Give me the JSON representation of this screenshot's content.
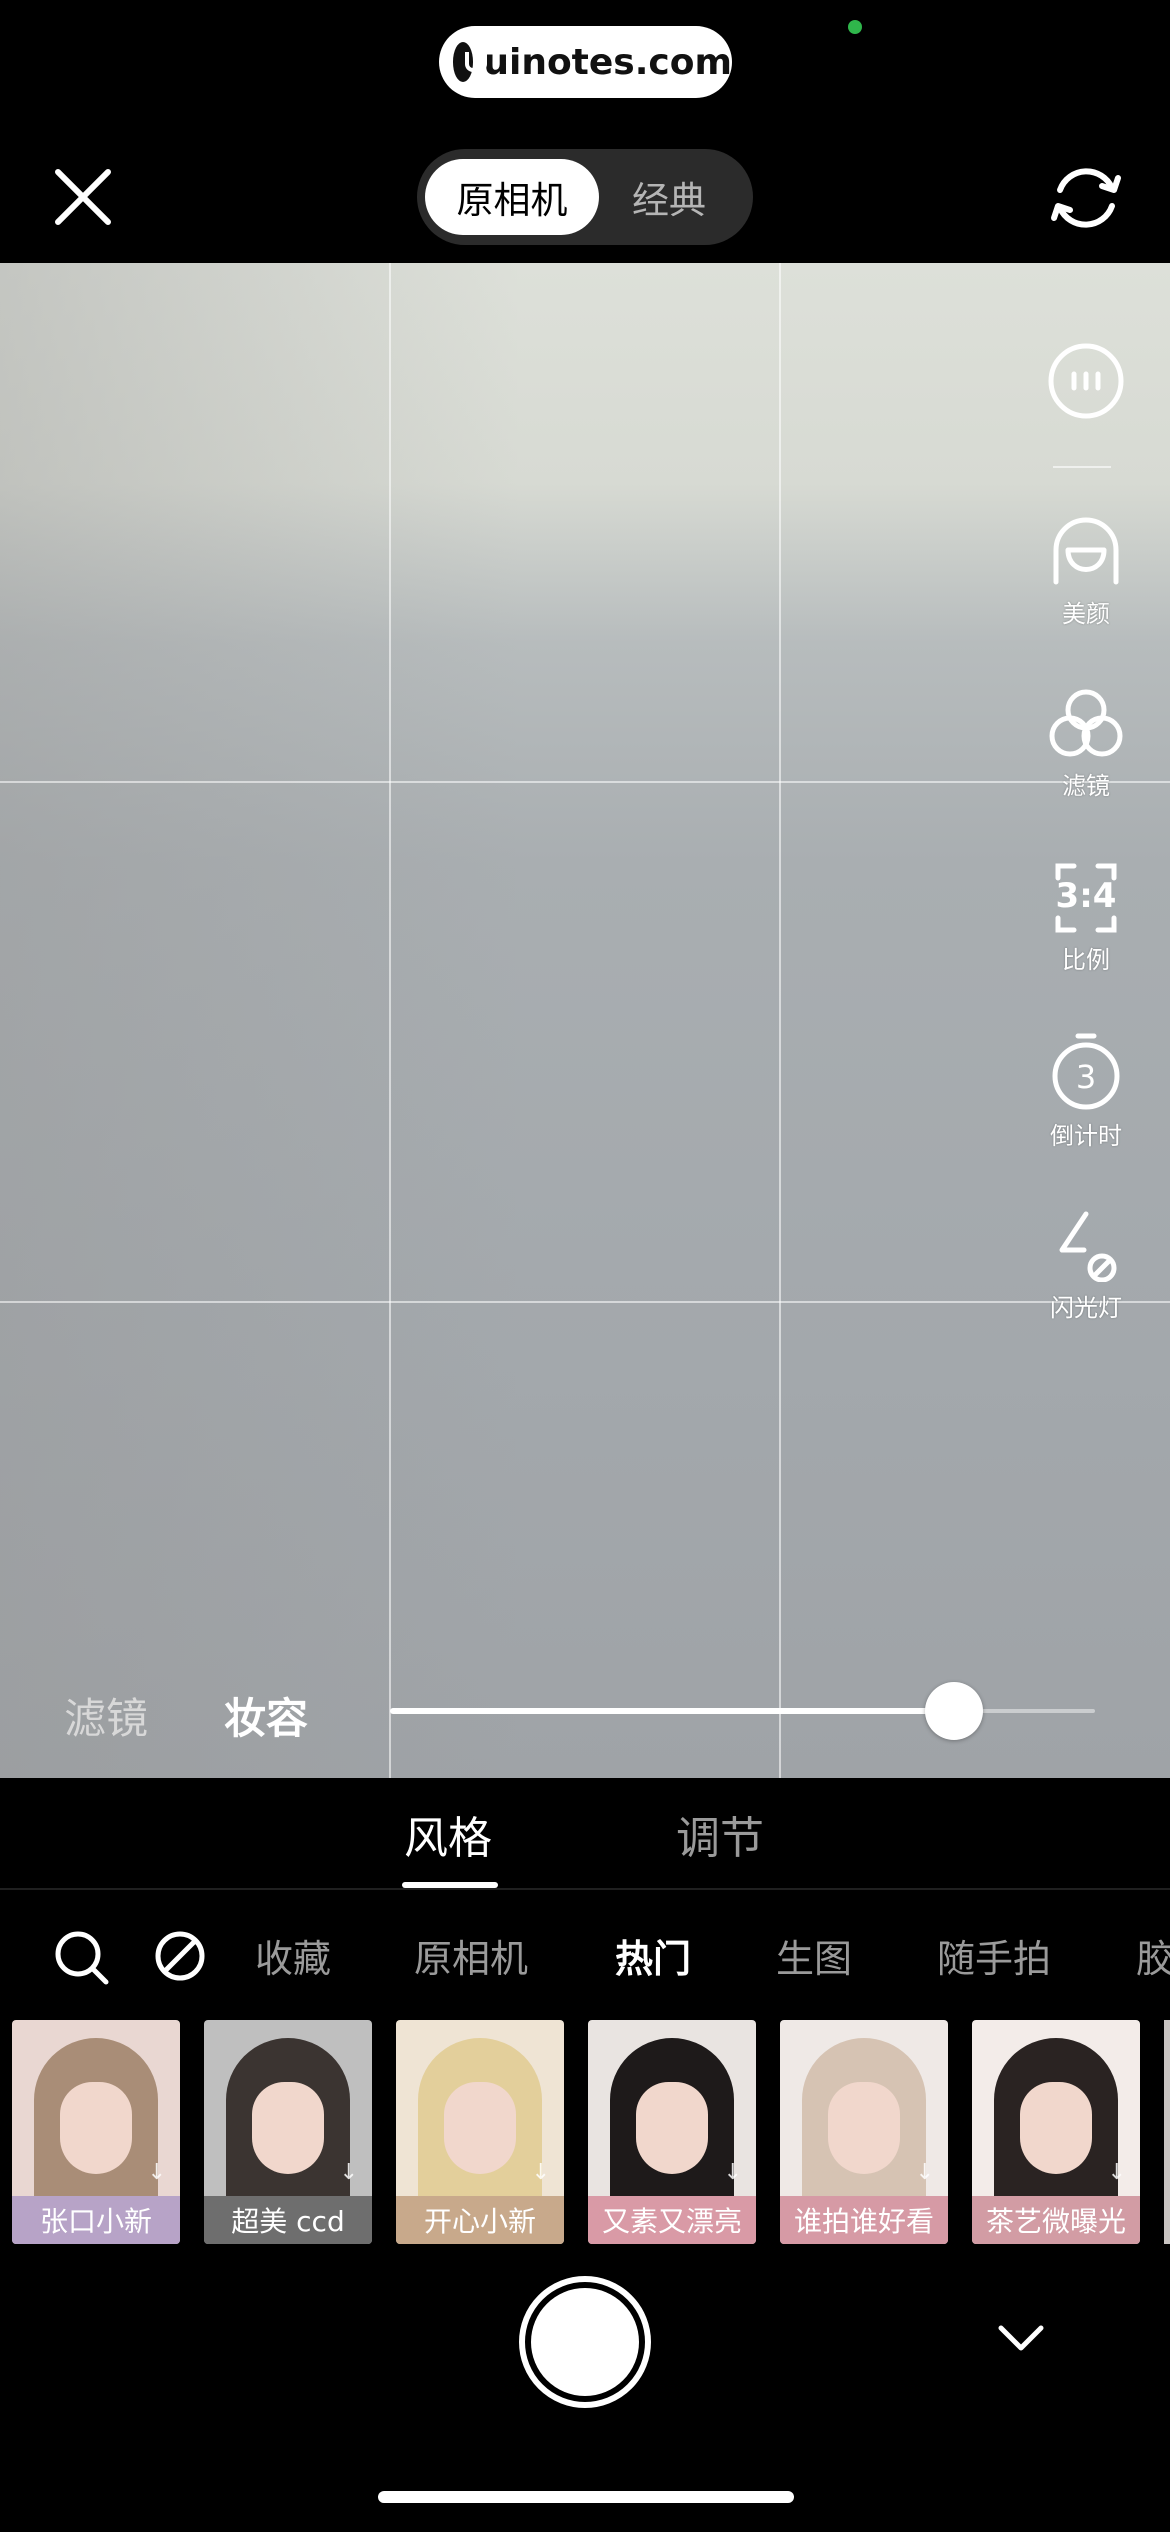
{
  "watermark": {
    "text": "uinotes.com"
  },
  "top_bar": {
    "close_icon": "close-icon",
    "modes": [
      "原相机",
      "经典"
    ],
    "active_mode": "原相机",
    "switch_camera_icon": "switch-camera-icon"
  },
  "side_tools": {
    "more_icon": "more-icon",
    "items": [
      {
        "label": "美颜",
        "icon": "beauty-icon"
      },
      {
        "label": "滤镜",
        "icon": "filter-icon"
      },
      {
        "label": "比例",
        "icon": "ratio-icon",
        "value": "3:4"
      },
      {
        "label": "倒计时",
        "icon": "timer-icon",
        "value": "3"
      },
      {
        "label": "闪光灯",
        "icon": "flash-off-icon"
      }
    ]
  },
  "intensity": {
    "tabs": [
      "滤镜",
      "妆容"
    ],
    "active_tab": "妆容",
    "value_fraction": 0.8
  },
  "panel": {
    "tabs": [
      "风格",
      "调节"
    ],
    "active_tab": "风格",
    "categories": [
      "收藏",
      "原相机",
      "热门",
      "生图",
      "随手拍",
      "胶"
    ],
    "active_category": "热门",
    "filters": [
      {
        "label": "张口小新",
        "label_bg": "#b7a3c7",
        "bg": "#e9d7d2",
        "hair": "#a98d77"
      },
      {
        "label": "超美 ccd",
        "label_bg": "#6e6e6e",
        "bg": "#bfbfbf",
        "hair": "#3b3431"
      },
      {
        "label": "开心小新",
        "label_bg": "#c8a98b",
        "bg": "#efe4d4",
        "hair": "#e3cf9b"
      },
      {
        "label": "又素又漂亮",
        "label_bg": "#d99aa6",
        "bg": "#e9e4e1",
        "hair": "#1e1a1a"
      },
      {
        "label": "谁拍谁好看",
        "label_bg": "#d69aa5",
        "bg": "#efe9e6",
        "hair": "#d6c3b3"
      },
      {
        "label": "茶艺微曝光",
        "label_bg": "#d29ca4",
        "bg": "#f3ece9",
        "hair": "#2a2322"
      }
    ]
  },
  "bottom": {
    "shutter_icon": "shutter-button",
    "collapse_icon": "chevron-down-icon"
  }
}
